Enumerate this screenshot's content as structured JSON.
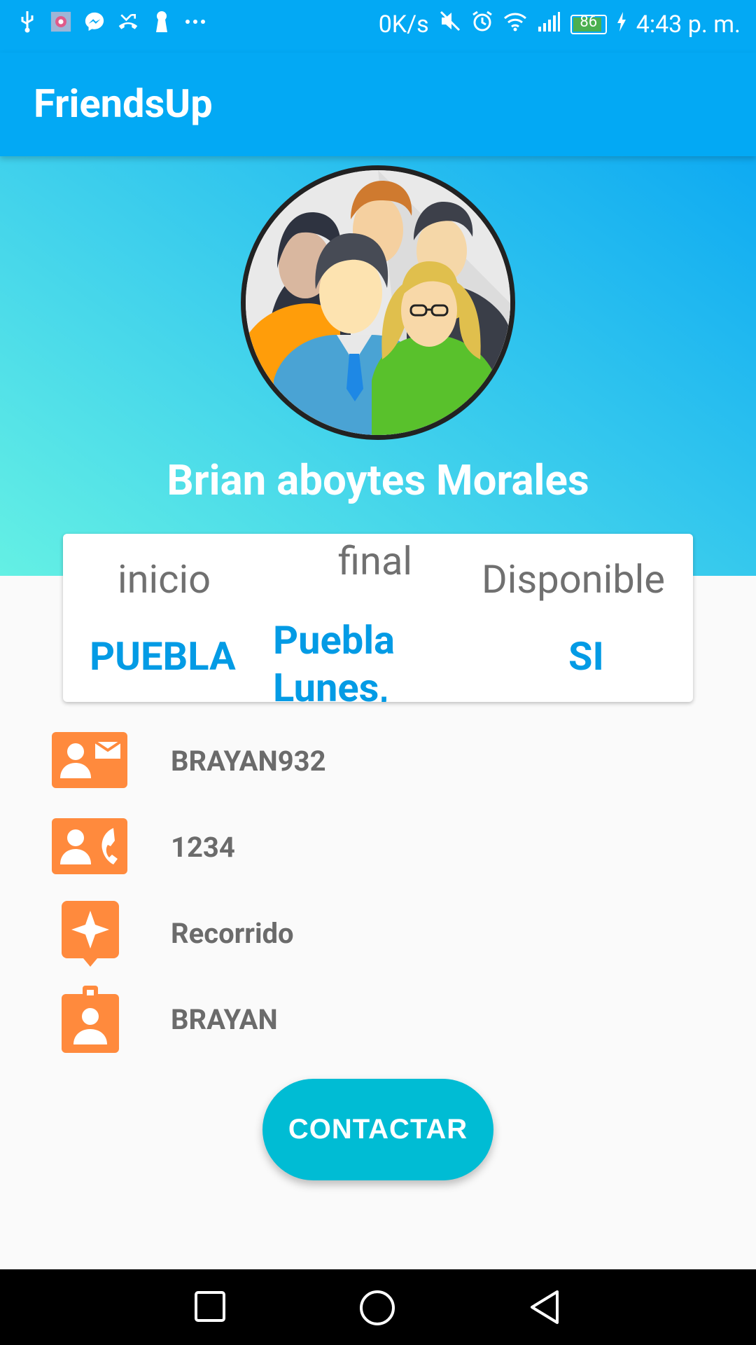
{
  "status_bar": {
    "net_speed": "0K/s",
    "battery": "86",
    "time": "4:43 p. m.",
    "left_icons": [
      "usb-icon",
      "image-icon",
      "messenger-icon",
      "missed-call-icon",
      "keyhole-icon",
      "more-dots-icon"
    ],
    "right_icons": [
      "mute-icon",
      "alarm-icon",
      "wifi-icon",
      "signal-icon",
      "battery-icon",
      "charging-icon"
    ]
  },
  "app_bar": {
    "title": "FriendsUp"
  },
  "profile": {
    "name": "Brian aboytes Morales",
    "avatar_icon": "group-people-avatar"
  },
  "card": {
    "columns": [
      {
        "label": "inicio",
        "value": "PUEBLA"
      },
      {
        "label": "final",
        "value": "Puebla Lunes,"
      },
      {
        "label": "Disponible",
        "value": "SI"
      }
    ]
  },
  "details": [
    {
      "icon": "contact-mail-icon",
      "text": "BRAYAN932"
    },
    {
      "icon": "contact-phone-icon",
      "text": "1234"
    },
    {
      "icon": "place-star-icon",
      "text": "Recorrido"
    },
    {
      "icon": "badge-icon",
      "text": "BRAYAN"
    }
  ],
  "button": {
    "label": "CONTACTAR"
  },
  "colors": {
    "primary": "#03a9f4",
    "accent": "#00bcd4",
    "icon_orange": "#ff8a3d",
    "value_blue": "#039be5"
  },
  "nav_bar": [
    "recent-apps-icon",
    "home-icon",
    "back-icon"
  ]
}
